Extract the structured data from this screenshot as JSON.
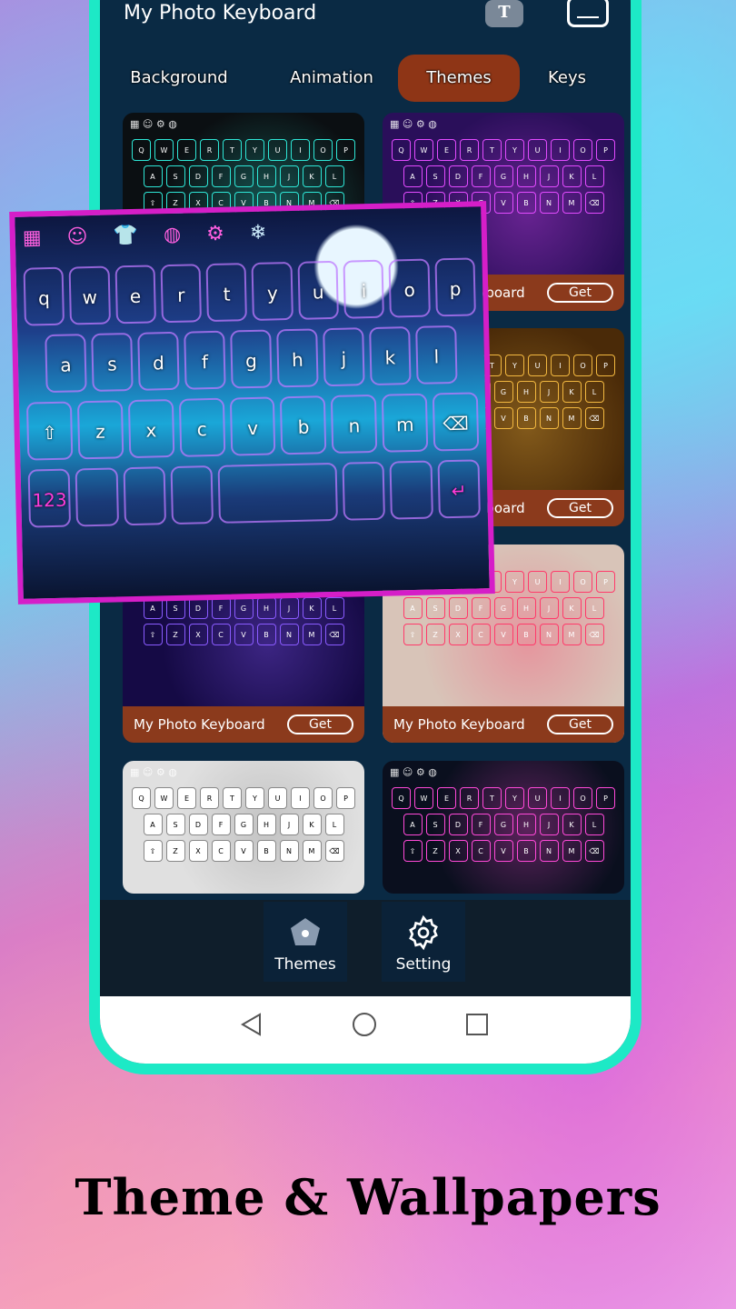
{
  "app": {
    "title": "My Photo Keyboard",
    "font_icon": "font-size-icon",
    "menu_icon": "window-icon"
  },
  "tabs": [
    {
      "label": "Background"
    },
    {
      "label": "Animation"
    },
    {
      "label": "Themes",
      "active": true
    },
    {
      "label": "Keys"
    }
  ],
  "theme_cards": [
    {
      "name": "",
      "get_label": "",
      "accent": "#2ee6d6",
      "bg": "#0b0f12"
    },
    {
      "name": "My Photo Keyboard",
      "get_label": "Get",
      "accent": "#e24bff",
      "bg": "#2a0f5a"
    },
    {
      "name": "",
      "get_label": "",
      "accent": "#28c8ff",
      "bg": "#0a1a40"
    },
    {
      "name": "My Photo Keyboard",
      "get_label": "Get",
      "accent": "#f2b840",
      "bg": "#4a2a08"
    },
    {
      "name": "My Photo Keyboard",
      "get_label": "Get",
      "accent": "#8a5bff",
      "bg": "#150a45"
    },
    {
      "name": "My Photo Keyboard",
      "get_label": "Get",
      "accent": "#ff3a6a",
      "bg": "#d8c4b8"
    },
    {
      "name": "",
      "get_label": "",
      "accent": "#888888",
      "bg": "#e0e0e0"
    },
    {
      "name": "",
      "get_label": "",
      "accent": "#ff49d8",
      "bg": "#0a0f1e"
    }
  ],
  "overlay_keyboard": {
    "rows": [
      [
        "q",
        "w",
        "e",
        "r",
        "t",
        "y",
        "u",
        "i",
        "o",
        "p"
      ],
      [
        "a",
        "s",
        "d",
        "f",
        "g",
        "h",
        "j",
        "k",
        "l"
      ],
      [
        "⇧",
        "z",
        "x",
        "c",
        "v",
        "b",
        "n",
        "m",
        "⌫"
      ],
      [
        "123",
        "",
        "",
        "",
        " ",
        "",
        "",
        "↵"
      ]
    ],
    "accent": "#d51ec8"
  },
  "bottom_nav": [
    {
      "label": "Themes",
      "icon": "pentagon-icon"
    },
    {
      "label": "Setting",
      "icon": "gear-icon"
    }
  ],
  "system_nav": [
    "back-icon",
    "home-icon",
    "recents-icon"
  ],
  "headline": "Theme & Wallpapers"
}
